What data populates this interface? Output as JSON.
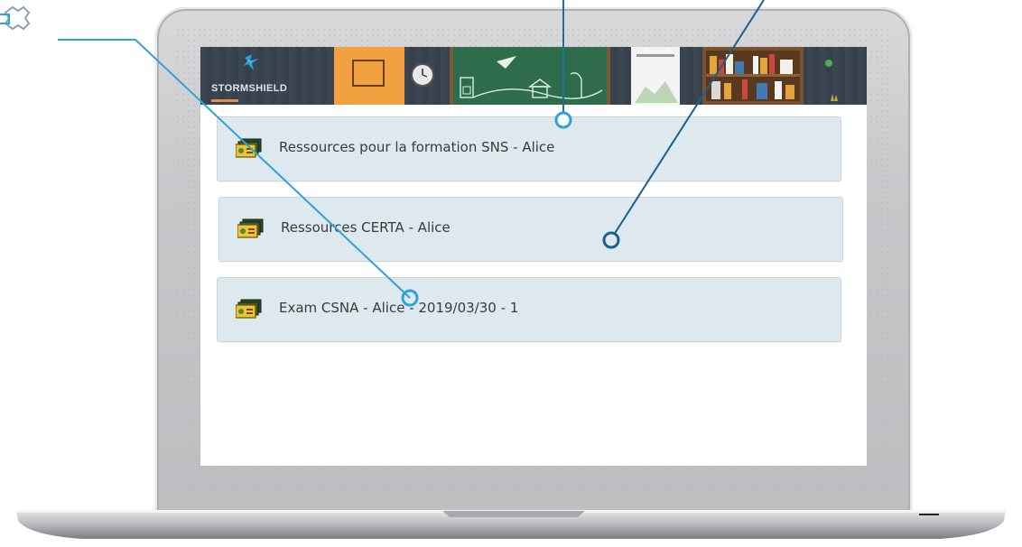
{
  "brand": {
    "logo_text": "STORMSHIELD"
  },
  "resources": [
    {
      "label": "Ressources pour la formation SNS - Alice"
    },
    {
      "label": "Ressources CERTA - Alice"
    },
    {
      "label": "Exam CSNA - Alice - 2019/03/30 - 1"
    }
  ],
  "colors": {
    "banner": "#3c4652",
    "card_background": "#dde9ee",
    "callout_light": "#2ea3d6",
    "callout_dark": "#1d5e8e",
    "accent_orange": "#f2a141",
    "chalkboard": "#2f6c4b"
  },
  "icons": {
    "resource_icon": "money-stack-icon",
    "callout_icon": "gear-icon"
  }
}
